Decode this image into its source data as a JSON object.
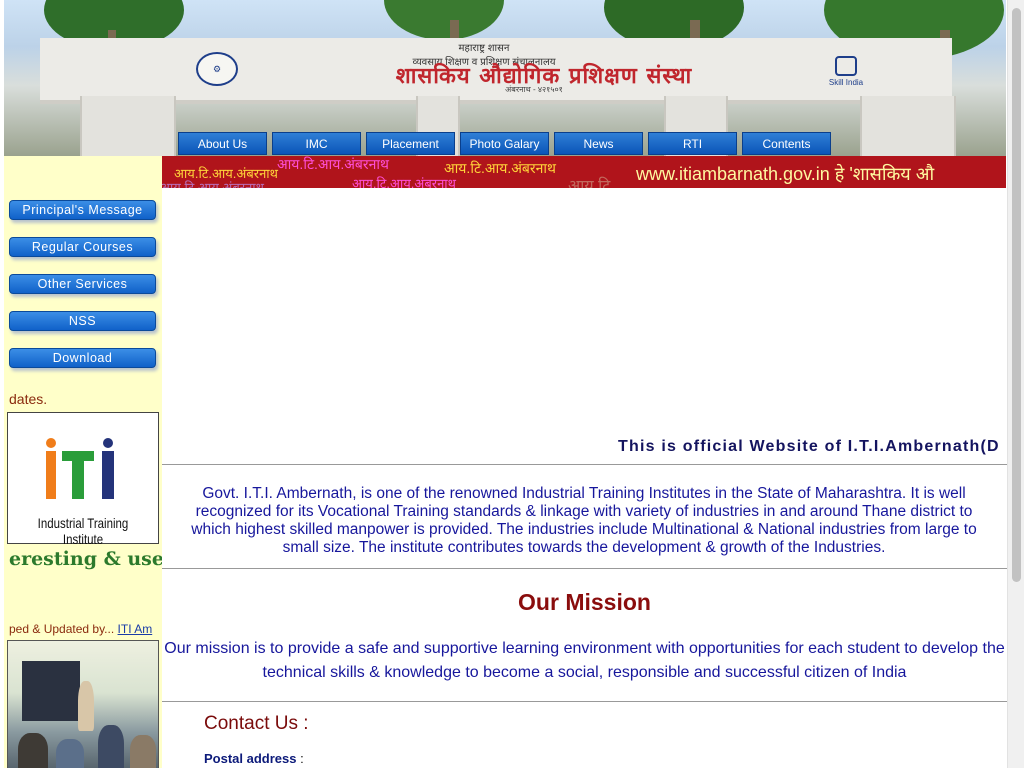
{
  "banner": {
    "top_text": "महाराष्ट्र शासन",
    "subtitle": "व्यवसाय शिक्षण व प्रशिक्षण संचालनालय",
    "title": "शासकिय औद्योगिक प्रशिक्षण संस्था",
    "place": "अंबरनाथ - ४२१५०१",
    "skill_india": "Skill India"
  },
  "top_nav": [
    {
      "label": "About Us"
    },
    {
      "label": "IMC"
    },
    {
      "label": "Placement"
    },
    {
      "label": "Photo Galary"
    },
    {
      "label": "News"
    },
    {
      "label": "RTI"
    },
    {
      "label": "Contents"
    }
  ],
  "sidebar": {
    "buttons": [
      {
        "label": "Principal's Message"
      },
      {
        "label": "Regular Courses"
      },
      {
        "label": "Other Services"
      },
      {
        "label": "NSS"
      },
      {
        "label": "Download"
      }
    ],
    "updates_text": "dates.",
    "iti_logo_caption": "Industrial Training Institute",
    "interest_text": "eresting & usefull",
    "dev_text": "ped & Updated by...",
    "dev_link": "ITI Am"
  },
  "strip": {
    "hindi_1": "आय.टि.आय.अंबरनाथ",
    "hindi_2": "आय.टि.आय.अंबरनाथ",
    "hindi_3": "आय.टि.आय.अंबरनाथ",
    "hindi_4": "आय.टि.आय.अंबरनाथ",
    "hindi_5": "आय.टि.आय.अंबरनाथ",
    "hindi_6": "आय टि",
    "url_text": "www.itiambarnath.gov.in  हे  'शासकिय औ"
  },
  "main": {
    "official_text": "This is official Website of I.T.I.Ambernath(D",
    "intro": "Govt. I.T.I. Ambernath, is one of the renowned Industrial Training Institutes in the State of Maharashtra. It is well recognized for its Vocational Training standards & linkage with variety of industries in and around Thane district to which highest skilled manpower is provided. The industries include Multinational & National industries from large to small size. The institute contributes towards the development & growth of the Industries.",
    "mission_heading": "Our Mission",
    "mission_text": "Our mission is to provide a safe and supportive learning environment with opportunities for each student to develop the technical skills & knowledge to become a social, responsible and successful citizen of India",
    "contact_heading": "Contact Us :",
    "postal_label": "Postal address",
    "postal_sep": " :"
  },
  "colors": {
    "nav_blue": "#0b55b8",
    "sidebar_bg": "#ffffc9",
    "strip_red": "#b0141b",
    "mission_red": "#8a0d0d",
    "text_navy": "#17179c"
  }
}
